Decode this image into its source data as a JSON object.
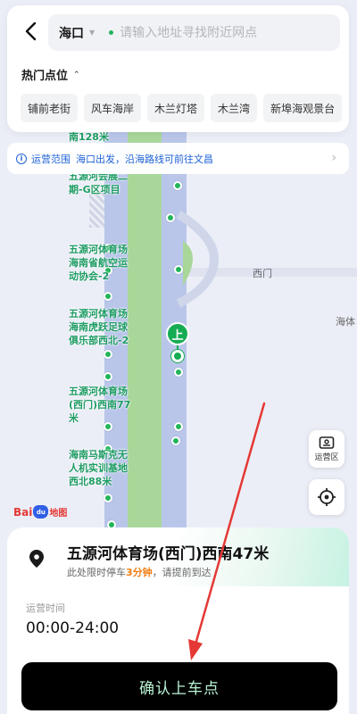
{
  "header": {
    "city": "海口",
    "search_placeholder": "请输入地址寻找附近网点",
    "hot_spots_title": "热门点位",
    "hot_spots": [
      "铺前老街",
      "风车海岸",
      "木兰灯塔",
      "木兰湾",
      "新埠海观景台"
    ]
  },
  "notice": {
    "label": "运营范围",
    "text": "海口出发，沿海路线可前往文昌"
  },
  "map": {
    "labels": {
      "top_fragment": "南128米",
      "fragment_2": "五源河会展二",
      "fragment_3": "期-G区项目",
      "stop_1": [
        "五源河体育场",
        "海南省航空运",
        "动协会-2"
      ],
      "stop_2": [
        "五源河体育场",
        "海南虎跃足球",
        "俱乐部西北-2"
      ],
      "stop_3": [
        "五源河体育场",
        "(西门)西南77",
        "米"
      ],
      "stop_4": [
        "海南马斯克无",
        "人机实训基地",
        "西北88米"
      ]
    },
    "street_west_gate": "西门",
    "street_right": "海体",
    "board_marker": "上",
    "logo": {
      "bai": "Bai",
      "paw": "du",
      "map": "地图"
    }
  },
  "controls": {
    "zone_label": "运营区"
  },
  "sheet": {
    "place_name": "五源河体育场(西门)西南47米",
    "park_prefix": "此处限时停车",
    "park_time": "3分钟",
    "park_suffix": "，请提前到达",
    "hours_label": "运营时间",
    "hours_value": "00:00-24:00",
    "confirm": "确认上车点"
  },
  "colors": {
    "accent_green": "#22b559",
    "notice_blue": "#1f63d8",
    "warning_orange": "#f07e14",
    "button_bg": "#000000",
    "button_text": "#b8f3d3",
    "annotation_red": "#e53935"
  }
}
